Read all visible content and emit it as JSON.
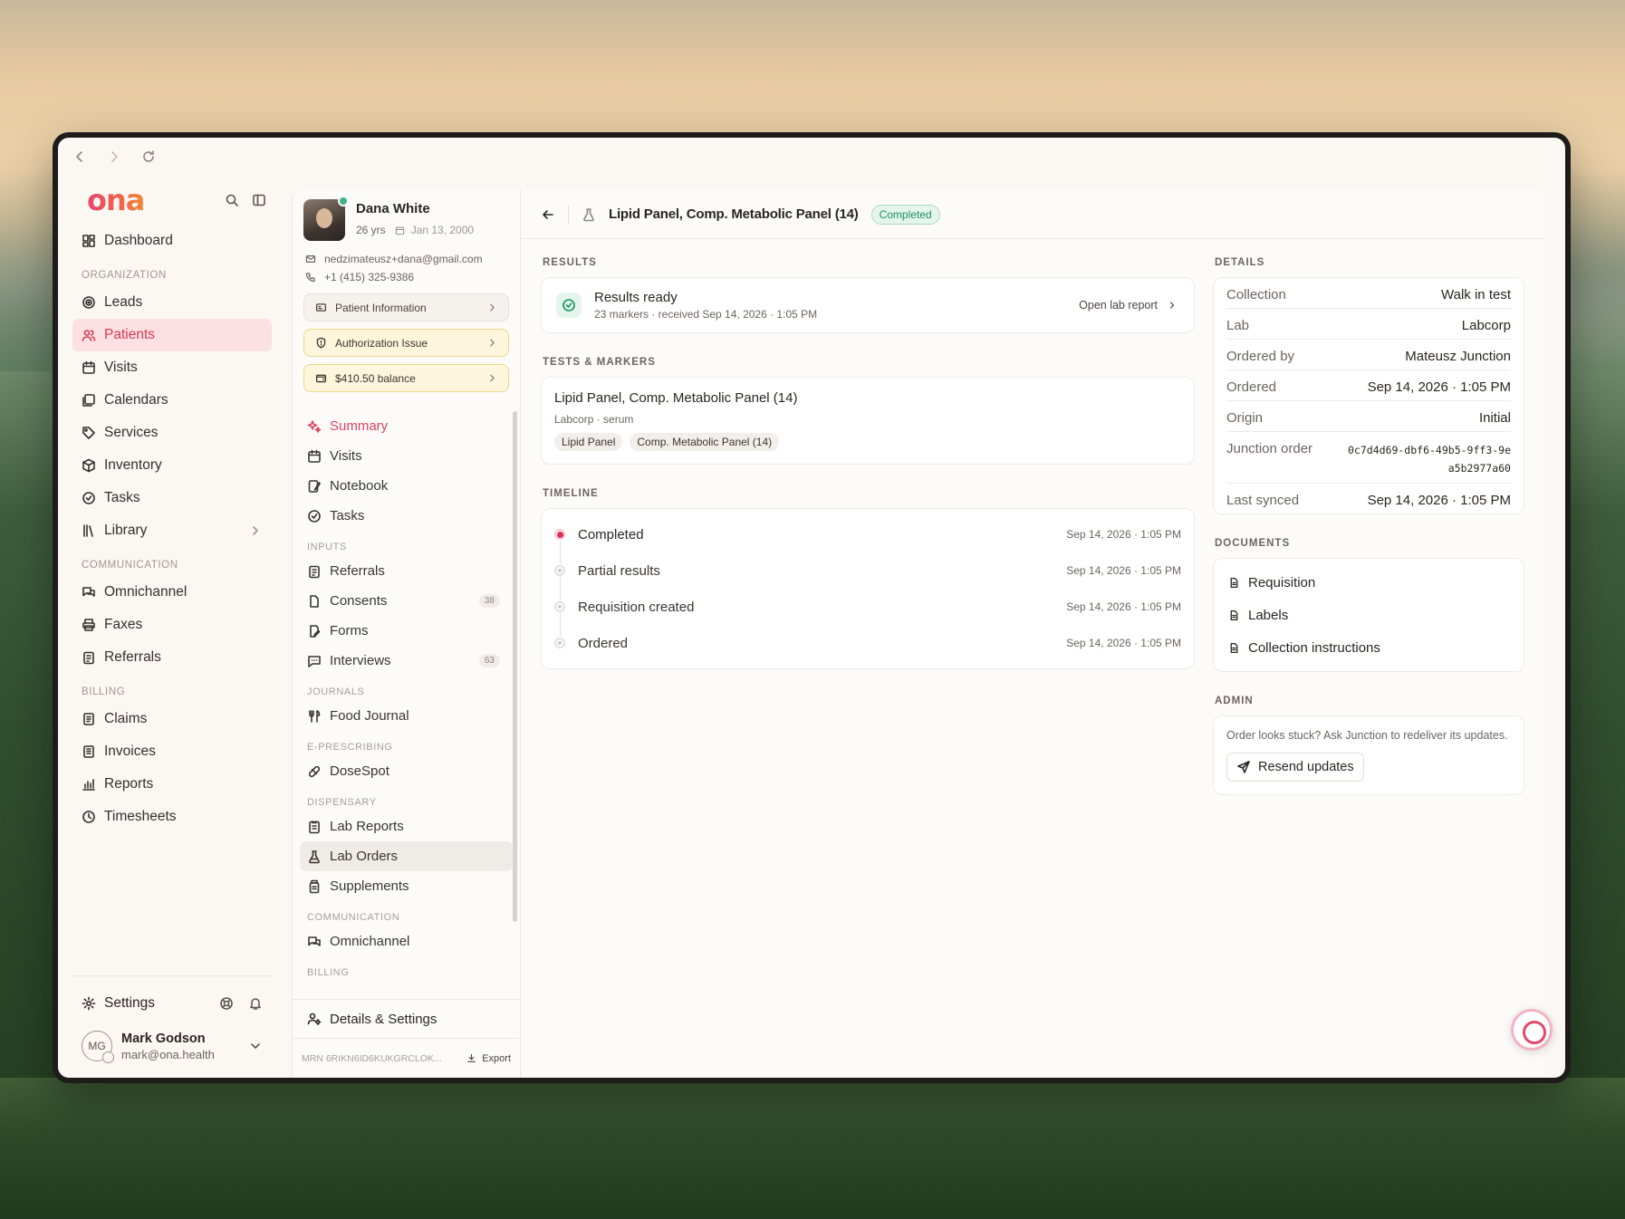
{
  "browser": {
    "back": "back-icon",
    "forward": "forward-icon",
    "reload": "reload-icon"
  },
  "brand": {
    "logo": "ona"
  },
  "sidebar": {
    "dashboard": "Dashboard",
    "sections": {
      "organization": "ORGANIZATION",
      "communication": "COMMUNICATION",
      "billing": "BILLING"
    },
    "organization": [
      "Leads",
      "Patients",
      "Visits",
      "Calendars",
      "Services",
      "Inventory",
      "Tasks",
      "Library"
    ],
    "communication": [
      "Omnichannel",
      "Faxes",
      "Referrals"
    ],
    "billing": [
      "Claims",
      "Invoices",
      "Reports",
      "Timesheets"
    ],
    "settings": "Settings",
    "user": {
      "initials": "MG",
      "name": "Mark Godson",
      "email": "mark@ona.health"
    }
  },
  "patient": {
    "name": "Dana White",
    "age": "26 yrs",
    "dob": "Jan 13, 2000",
    "email": "nedzimateusz+dana@gmail.com",
    "phone": "+1 (415) 325-9386",
    "info_button": "Patient Information",
    "auth_issue": "Authorization Issue",
    "balance": "$410.50 balance",
    "nav": {
      "summary": "Summary",
      "visits": "Visits",
      "notebook": "Notebook",
      "tasks": "Tasks",
      "inputs_label": "INPUTS",
      "referrals": "Referrals",
      "consents": "Consents",
      "consents_count": "38",
      "forms": "Forms",
      "interviews": "Interviews",
      "interviews_count": "63",
      "journals_label": "JOURNALS",
      "food_journal": "Food Journal",
      "eprescribing_label": "E-PRESCRIBING",
      "dosespot": "DoseSpot",
      "dispensary_label": "DISPENSARY",
      "lab_reports": "Lab Reports",
      "lab_orders": "Lab Orders",
      "supplements": "Supplements",
      "communication_label": "COMMUNICATION",
      "omnichannel": "Omnichannel",
      "billing_label": "BILLING"
    },
    "details_settings": "Details & Settings",
    "mrn": "MRN 6RIKN6ID6KUKGRCLOK...",
    "export": "Export"
  },
  "main": {
    "title": "Lipid Panel, Comp. Metabolic Panel (14)",
    "status": "Completed",
    "results_label": "RESULTS",
    "results": {
      "title": "Results ready",
      "sub": "23 markers · received Sep 14, 2026 · 1:05 PM",
      "link": "Open lab report"
    },
    "tests_label": "TESTS & MARKERS",
    "tests": {
      "title": "Lipid Panel, Comp. Metabolic Panel (14)",
      "sub": "Labcorp · serum",
      "tags": [
        "Lipid Panel",
        "Comp. Metabolic Panel (14)"
      ]
    },
    "timeline_label": "TIMELINE",
    "timeline": [
      {
        "label": "Completed",
        "time": "Sep 14, 2026 · 1:05 PM"
      },
      {
        "label": "Partial results",
        "time": "Sep 14, 2026 · 1:05 PM"
      },
      {
        "label": "Requisition created",
        "time": "Sep 14, 2026 · 1:05 PM"
      },
      {
        "label": "Ordered",
        "time": "Sep 14, 2026 · 1:05 PM"
      }
    ],
    "details_label": "DETAILS",
    "details": [
      {
        "key": "Collection",
        "value": "Walk in test"
      },
      {
        "key": "Lab",
        "value": "Labcorp"
      },
      {
        "key": "Ordered by",
        "value": "Mateusz Junction"
      },
      {
        "key": "Ordered",
        "value": "Sep 14, 2026 · 1:05 PM"
      },
      {
        "key": "Origin",
        "value": "Initial"
      },
      {
        "key": "Junction order",
        "value": "0c7d4d69-dbf6-49b5-9ff3-9ea5b2977a60"
      },
      {
        "key": "Last synced",
        "value": "Sep 14, 2026 · 1:05 PM"
      }
    ],
    "documents_label": "DOCUMENTS",
    "documents": [
      "Requisition",
      "Labels",
      "Collection instructions"
    ],
    "admin_label": "ADMIN",
    "admin": {
      "text": "Order looks stuck? Ask Junction to redeliver its updates.",
      "button": "Resend updates"
    }
  },
  "colors": {
    "accent": "#dd4461",
    "active_bg": "#fde0e2",
    "success": "#1d8f63",
    "warn_bg": "#fdf6dc"
  }
}
